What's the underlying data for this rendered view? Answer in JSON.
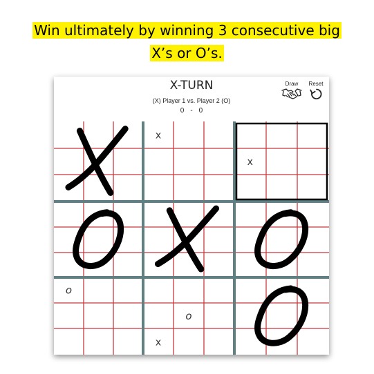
{
  "caption": {
    "line1": "Win ultimately by winning 3 consecutive big",
    "line2": "X’s or O’s."
  },
  "game": {
    "title": "X-TURN",
    "players": "(X) Player 1 vs. Player 2 (O)",
    "score_p1": "0",
    "score_sep": "-",
    "score_p2": "0"
  },
  "controls": {
    "draw_label": "Draw",
    "draw_icon": "handshake-icon",
    "reset_label": "Reset",
    "reset_icon": "refresh-icon"
  },
  "colors": {
    "caption_highlight": "#fff200",
    "sub_grid_lines": "#c8383e",
    "major_grid_lines": "#5f7f82",
    "active_board_border": "#000000",
    "big_marks": "#000000"
  },
  "board": {
    "big_marks": [
      [
        "X",
        "",
        ""
      ],
      [
        "O",
        "X",
        "O"
      ],
      [
        "",
        "",
        "O"
      ]
    ],
    "small_marks": [
      {
        "big_row": 0,
        "big_col": 1,
        "row": 0,
        "col": 0,
        "mark": "x"
      },
      {
        "big_row": 0,
        "big_col": 2,
        "row": 1,
        "col": 0,
        "mark": "x"
      },
      {
        "big_row": 2,
        "big_col": 0,
        "row": 0,
        "col": 0,
        "mark": "o"
      },
      {
        "big_row": 2,
        "big_col": 1,
        "row": 1,
        "col": 1,
        "mark": "o"
      },
      {
        "big_row": 2,
        "big_col": 1,
        "row": 2,
        "col": 0,
        "mark": "x"
      }
    ],
    "active_big_cell": {
      "row": 0,
      "col": 2
    }
  }
}
